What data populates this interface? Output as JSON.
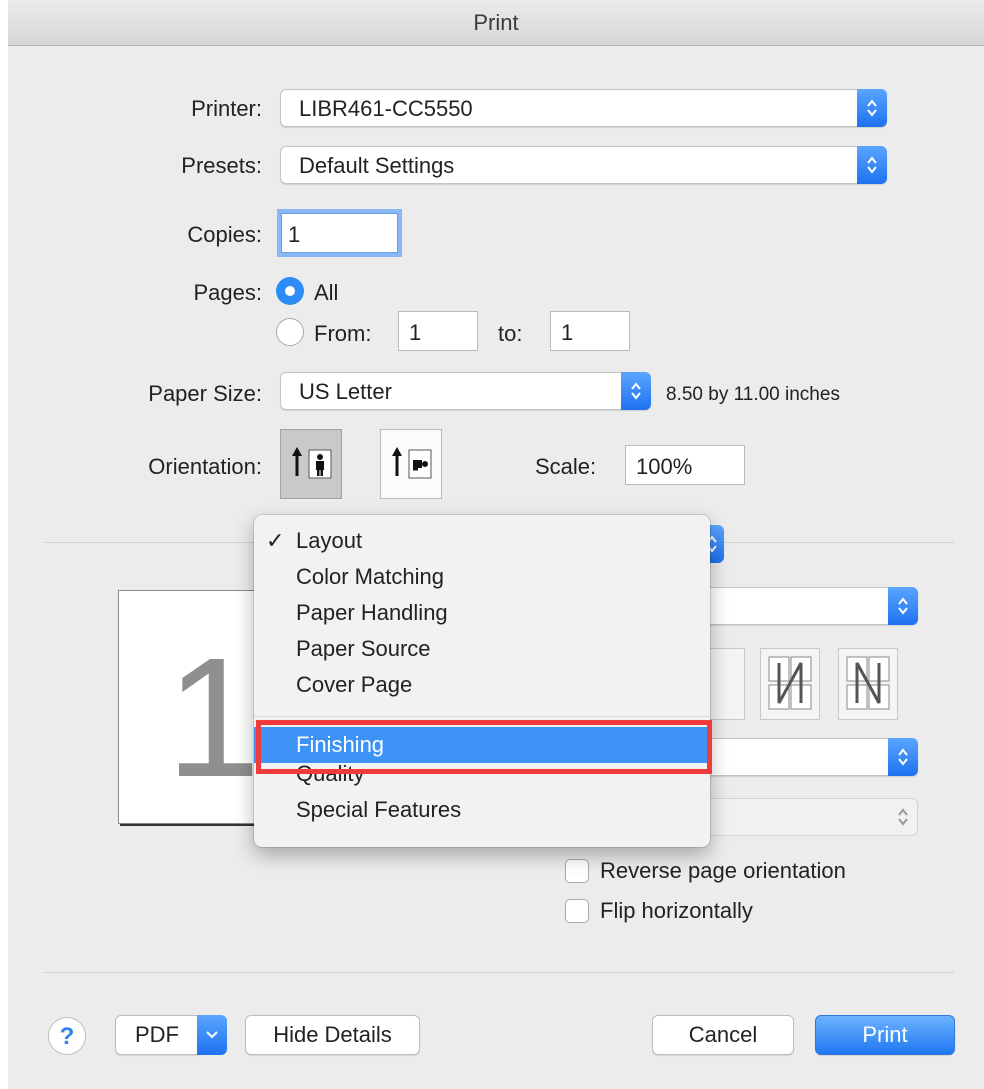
{
  "window": {
    "title": "Print"
  },
  "printer": {
    "label": "Printer:",
    "value": "LIBR461-CC5550"
  },
  "presets": {
    "label": "Presets:",
    "value": "Default Settings"
  },
  "copies": {
    "label": "Copies:",
    "value": "1"
  },
  "pages": {
    "label": "Pages:",
    "all_label": "All",
    "from_label": "From:",
    "from_value": "1",
    "to_label": "to:",
    "to_value": "1",
    "selected": "All"
  },
  "paper_size": {
    "label": "Paper Size:",
    "value": "US Letter",
    "dimensions": "8.50 by 11.00 inches"
  },
  "orientation": {
    "label": "Orientation:",
    "selected": "portrait"
  },
  "scale": {
    "label": "Scale:",
    "value": "100%"
  },
  "preview": {
    "page_number": "1"
  },
  "section_menu": {
    "items": [
      {
        "label": "Layout",
        "checked": true
      },
      {
        "label": "Color Matching"
      },
      {
        "label": "Paper Handling"
      },
      {
        "label": "Paper Source"
      },
      {
        "label": "Cover Page"
      },
      {
        "label": "Finishing",
        "highlighted": true
      },
      {
        "label": "Quality"
      },
      {
        "label": "Special Features"
      }
    ],
    "check_glyph": "✓"
  },
  "options": {
    "reverse_orientation": {
      "label": "Reverse page orientation",
      "checked": false
    },
    "flip_horizontally": {
      "label": "Flip horizontally",
      "checked": false
    }
  },
  "footer": {
    "help": "?",
    "pdf": "PDF",
    "hide_details": "Hide Details",
    "cancel": "Cancel",
    "print": "Print"
  },
  "colors": {
    "accent": "#2d8cf5",
    "highlight_box": "#ef3b3b",
    "menu_highlight": "#3d92f5"
  }
}
